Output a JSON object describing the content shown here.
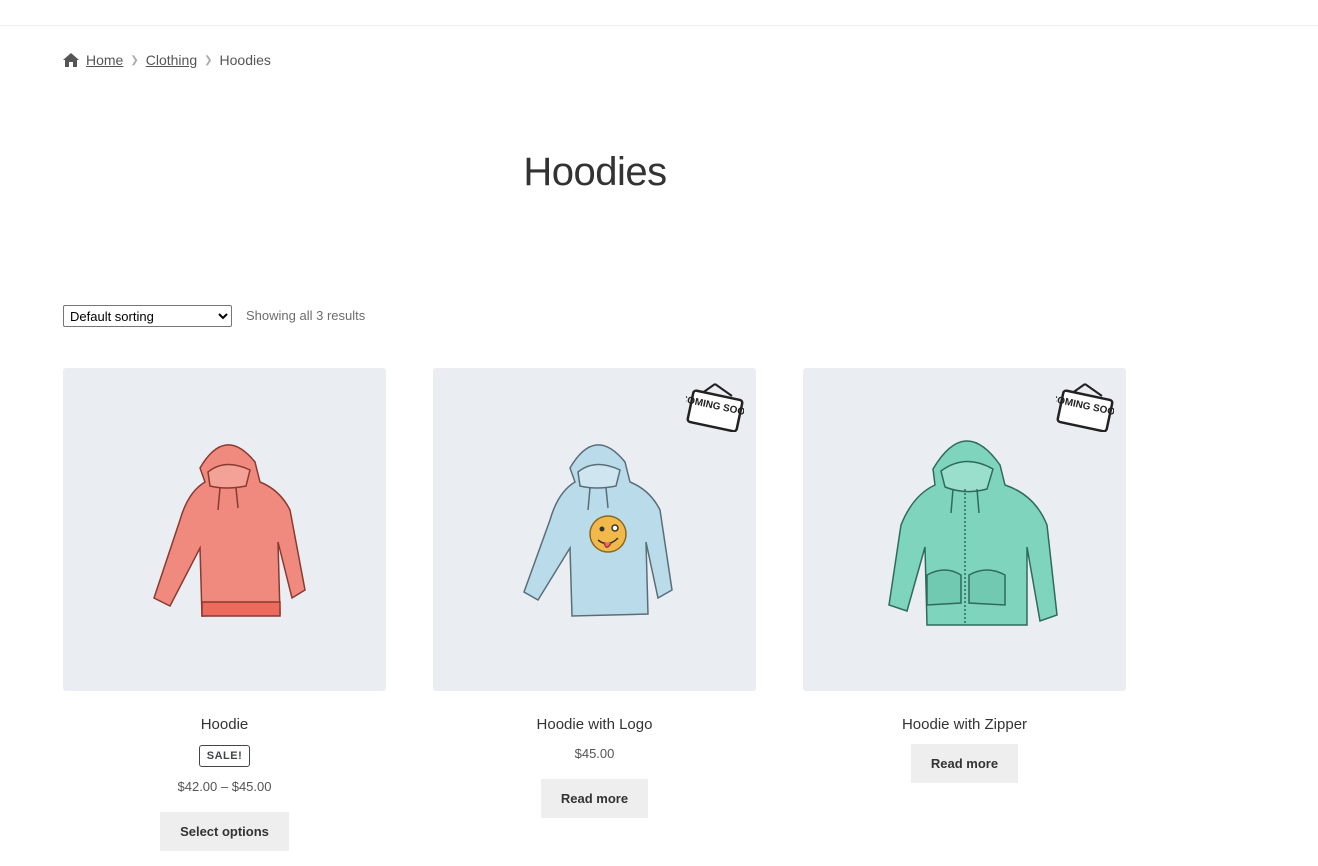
{
  "breadcrumb": {
    "home": "Home",
    "clothing": "Clothing",
    "current": "Hoodies"
  },
  "page_title": "Hoodies",
  "sorting": {
    "selected": "Default sorting"
  },
  "result_count": "Showing all 3 results",
  "icons": {
    "home": "home-icon",
    "separator": "chevron-right-icon",
    "badge": "coming-soon-sign-icon"
  },
  "colors": {
    "image_bg": "#eaeef2",
    "button_bg": "#eeeeee",
    "hoodie_red": "#f08a7e",
    "hoodie_blue": "#b9dbea",
    "hoodie_green": "#7fd4bd"
  },
  "products": [
    {
      "title": "Hoodie",
      "badge": "SALE!",
      "price": "$42.00 – $45.00",
      "button": "Select options"
    },
    {
      "title": "Hoodie with Logo",
      "price": "$45.00",
      "button": "Read more",
      "coming_soon": "COMING SOON"
    },
    {
      "title": "Hoodie with Zipper",
      "button": "Read more",
      "coming_soon": "COMING SOON"
    }
  ]
}
